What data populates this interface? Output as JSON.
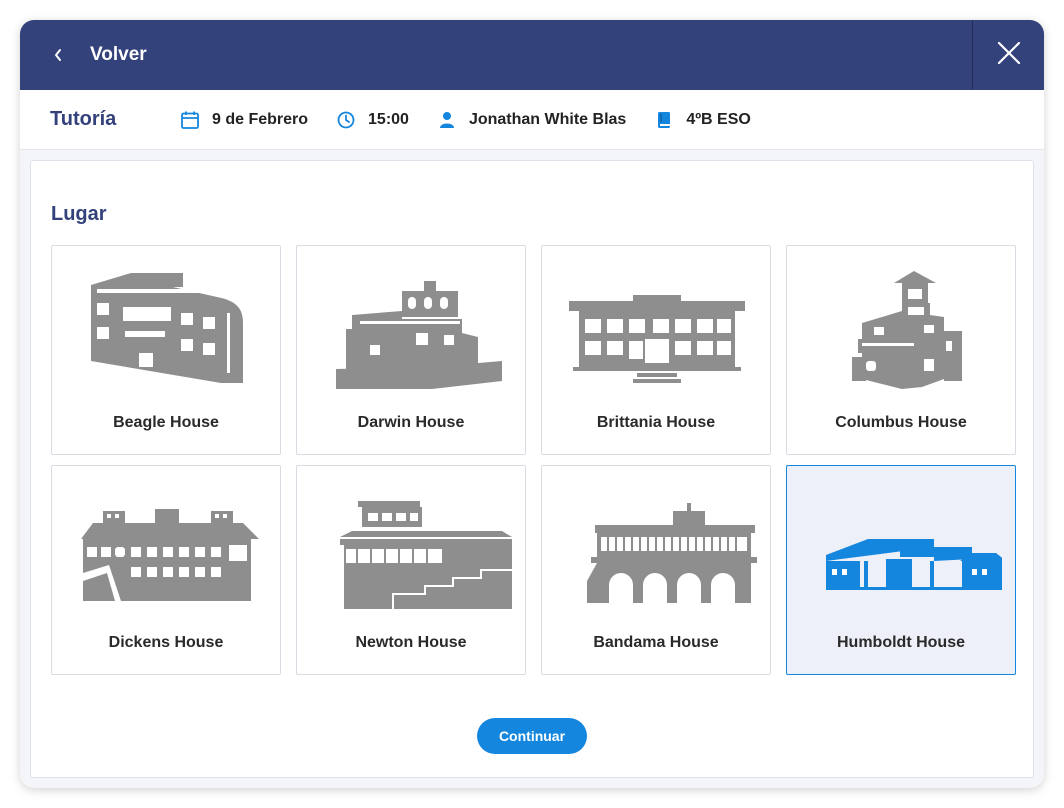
{
  "header": {
    "back_label": "Volver"
  },
  "info": {
    "title": "Tutoría",
    "date": "9 de Febrero",
    "time": "15:00",
    "person": "Jonathan White Blas",
    "group": "4ºB ESO"
  },
  "section": {
    "title": "Lugar"
  },
  "places": [
    {
      "name": "Beagle House"
    },
    {
      "name": "Darwin House"
    },
    {
      "name": "Brittania House"
    },
    {
      "name": "Columbus House"
    },
    {
      "name": "Dickens House"
    },
    {
      "name": "Newton House"
    },
    {
      "name": "Bandama House"
    },
    {
      "name": "Humboldt House"
    }
  ],
  "selected_place": "Humboldt House",
  "actions": {
    "continue_label": "Continuar"
  },
  "colors": {
    "header_bg": "#34427c",
    "accent": "#1486de",
    "building_gray": "#8e8e8e",
    "selected_bg": "#edf0f8"
  }
}
